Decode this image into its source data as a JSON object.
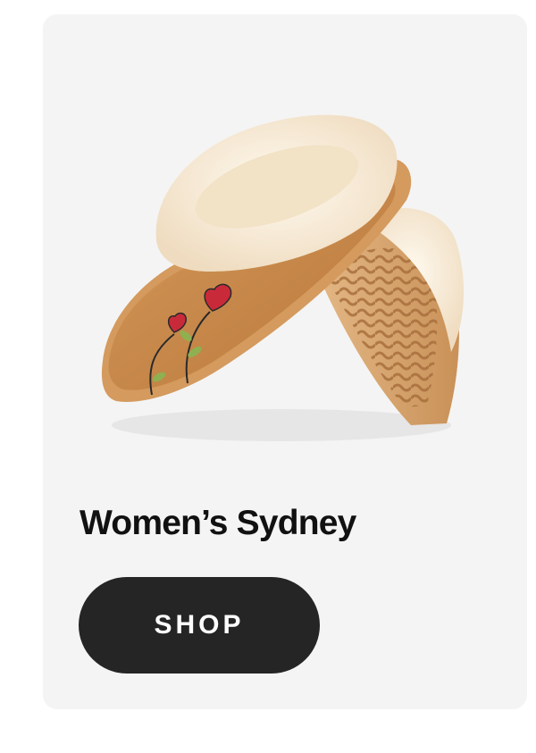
{
  "product": {
    "title": "Women’s Sydney",
    "image_alt": "Pair of tan suede slippers with sheepskin collar and embroidered heart flowers",
    "image_icon": "slipper-image"
  },
  "cta": {
    "label": "SHOP"
  },
  "colors": {
    "card_background": "#f4f4f4",
    "button_background": "#252525",
    "button_text": "#ffffff",
    "title_text": "#111111",
    "suede": "#c98a4b",
    "fleece": "#f6ead7",
    "sole": "#d7a46e",
    "heart_red": "#c92a3a",
    "stem_green": "#7fa04a"
  }
}
